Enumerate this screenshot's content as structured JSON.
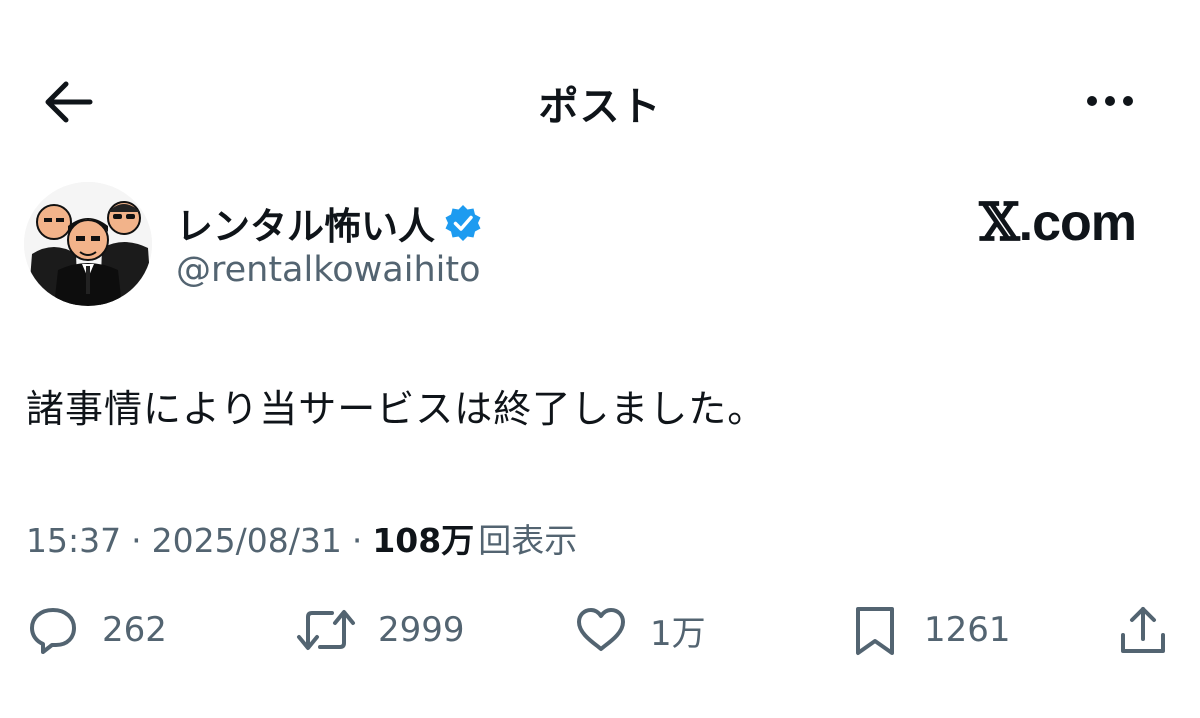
{
  "header": {
    "title": "ポスト"
  },
  "author": {
    "name": "レンタル怖い人",
    "handle": "@rentalkowaihito",
    "verified": true
  },
  "brand": {
    "mark": "𝕏",
    "domain": ".com"
  },
  "post": {
    "text": "諸事情により当サービスは終了しました。",
    "time": "15:37",
    "date": "2025/08/31",
    "views_count": "108万",
    "views_label": "回表示",
    "separator": "·"
  },
  "actions": {
    "replies": "262",
    "reposts": "2999",
    "likes": "1万",
    "bookmarks": "1261"
  },
  "colors": {
    "text": "#0f1419",
    "secondary": "#536471",
    "verified": "#1d9bf0"
  }
}
